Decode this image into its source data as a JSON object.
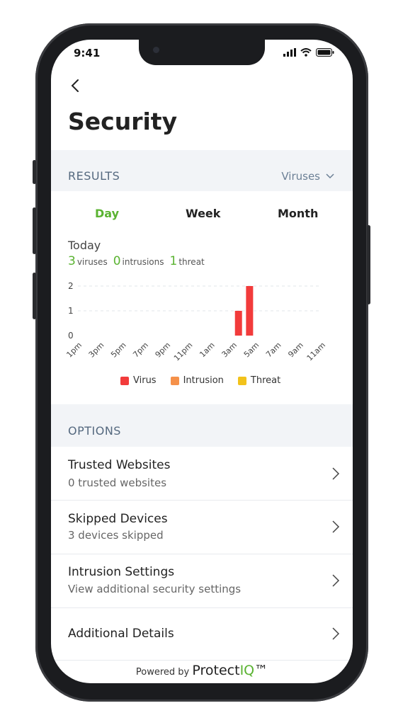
{
  "status": {
    "time": "9:41"
  },
  "header": {
    "title": "Security"
  },
  "results": {
    "label": "RESULTS",
    "filter": "Viruses",
    "tabs": [
      {
        "label": "Day",
        "active": true
      },
      {
        "label": "Week",
        "active": false
      },
      {
        "label": "Month",
        "active": false
      }
    ],
    "period": "Today",
    "counts": {
      "viruses": "3",
      "viruses_label": "viruses",
      "intrusions": "0",
      "intrusions_label": "intrusions",
      "threats": "1",
      "threats_label": "threat"
    }
  },
  "chart_data": {
    "type": "bar",
    "categories": [
      "1pm",
      "3pm",
      "5pm",
      "7pm",
      "9pm",
      "11pm",
      "1am",
      "3am",
      "5am",
      "7am",
      "9am",
      "11am"
    ],
    "series": [
      {
        "name": "Virus",
        "color": "#f23b3b",
        "x": [
          "3am",
          "4am"
        ],
        "values": [
          1,
          2
        ]
      },
      {
        "name": "Intrusion",
        "color": "#f5914a",
        "x": [],
        "values": []
      },
      {
        "name": "Threat",
        "color": "#f2c21b",
        "x": [],
        "values": []
      }
    ],
    "yticks": [
      0,
      1,
      2
    ],
    "ylim": [
      0,
      2
    ],
    "grid": true,
    "legend": "bottom"
  },
  "options": {
    "label": "OPTIONS",
    "items": [
      {
        "title": "Trusted Websites",
        "subtitle": "0 trusted websites"
      },
      {
        "title": "Skipped Devices",
        "subtitle": "3 devices skipped"
      },
      {
        "title": "Intrusion Settings",
        "subtitle": "View additional security settings"
      },
      {
        "title": "Additional Details",
        "subtitle": ""
      }
    ]
  },
  "footer": {
    "powered": "Powered by",
    "brand_a": "Protect",
    "brand_b": "IQ",
    "tm": "™"
  }
}
